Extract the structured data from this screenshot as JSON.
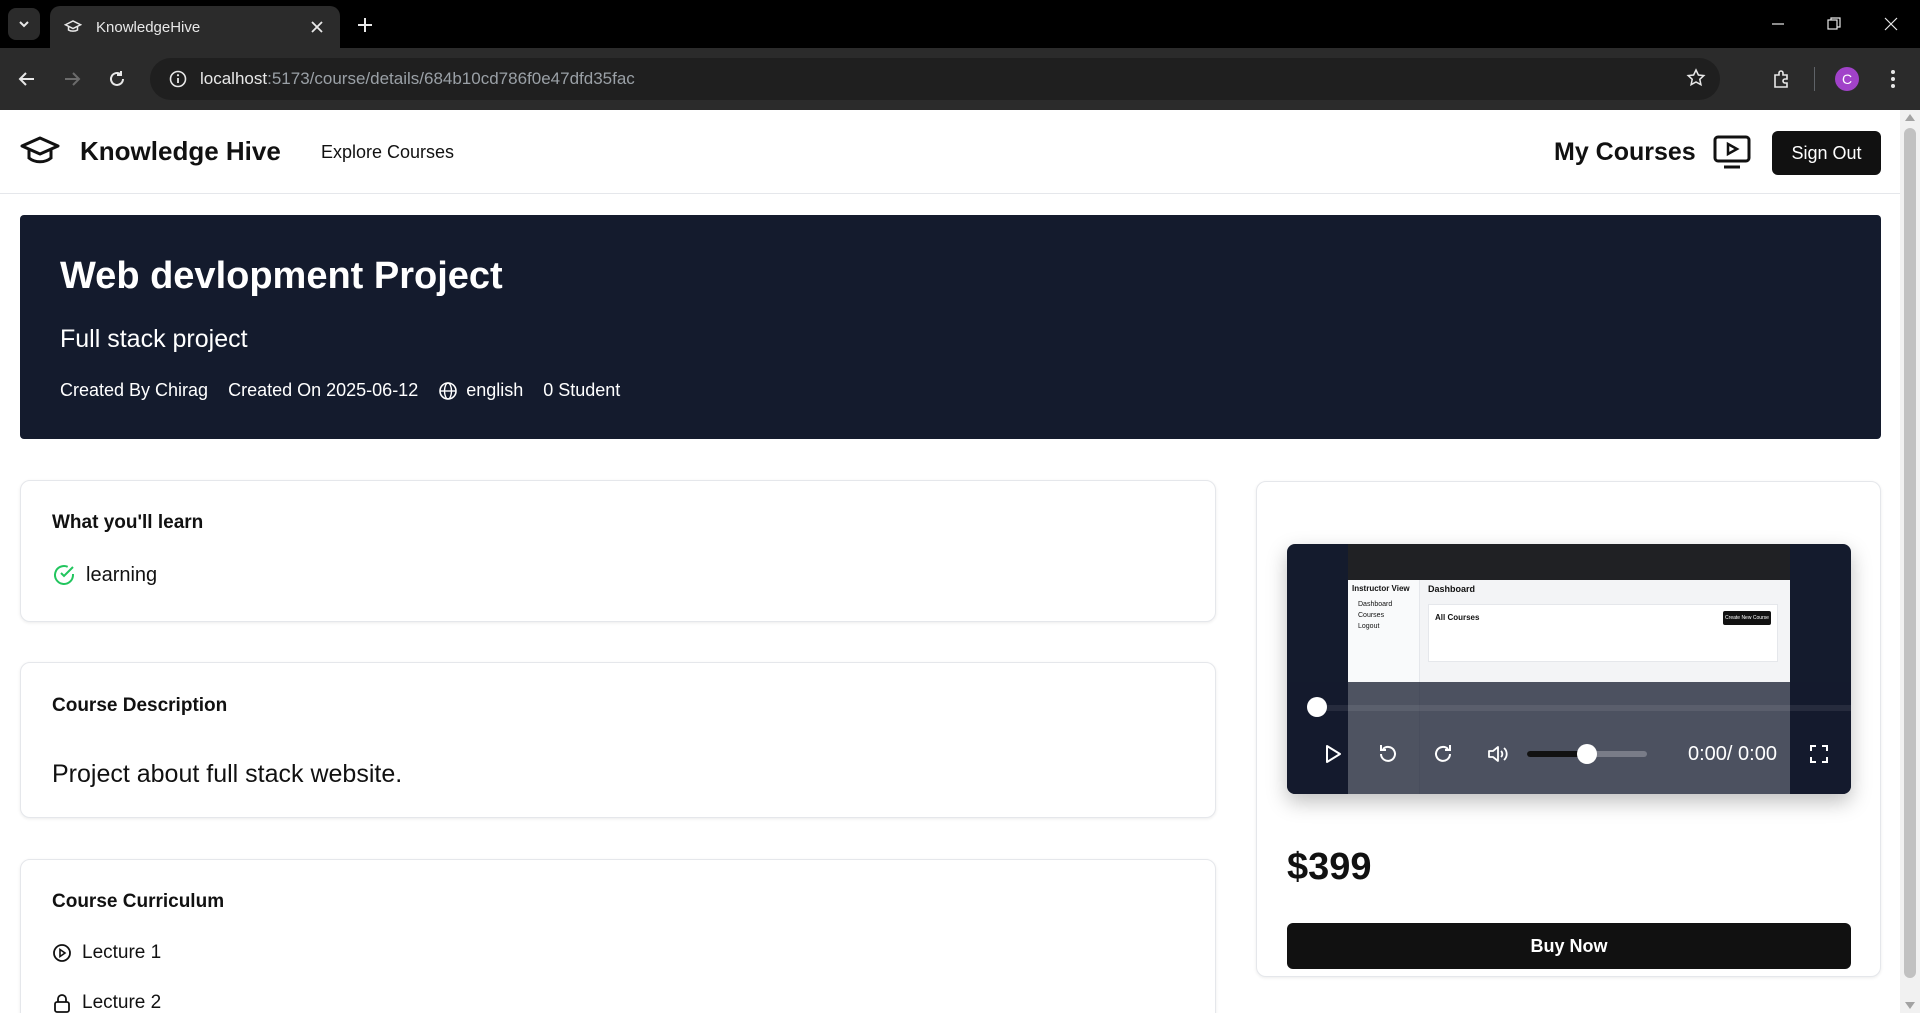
{
  "browser": {
    "tab_title": "KnowledgeHive",
    "url_host": "localhost",
    "url_path": ":5173/course/details/684b10cd786f0e47dfd35fac",
    "profile_initial": "C"
  },
  "header": {
    "brand": "Knowledge Hive",
    "explore": "Explore Courses",
    "my_courses": "My Courses",
    "sign_out": "Sign Out"
  },
  "hero": {
    "title": "Web devlopment Project",
    "subtitle": "Full stack project",
    "created_by": "Created By Chirag",
    "created_on": "Created On 2025-06-12",
    "language": "english",
    "students": "0 Student"
  },
  "learn": {
    "heading": "What you'll learn",
    "items": [
      "learning"
    ]
  },
  "description": {
    "heading": "Course Description",
    "text": "Project about full stack website."
  },
  "curriculum": {
    "heading": "Course Curriculum",
    "lectures": [
      {
        "title": "Lecture 1",
        "icon": "play-circle-icon"
      },
      {
        "title": "Lecture 2",
        "icon": "lock-icon"
      }
    ]
  },
  "preview": {
    "thumbnail": {
      "sidebar_title": "Instructor View",
      "sidebar_items": [
        "Dashboard",
        "Courses",
        "Logout"
      ],
      "main_title": "Dashboard",
      "panel_title": "All Courses",
      "panel_button": "Create New Course"
    },
    "time": "0:00/ 0:00",
    "volume_level": 0.5,
    "progress": 0
  },
  "purchase": {
    "price": "$399",
    "buy_label": "Buy Now"
  },
  "colors": {
    "hero_bg": "#141b2d",
    "accent_green": "#22c55e",
    "button_dark": "#111111"
  }
}
